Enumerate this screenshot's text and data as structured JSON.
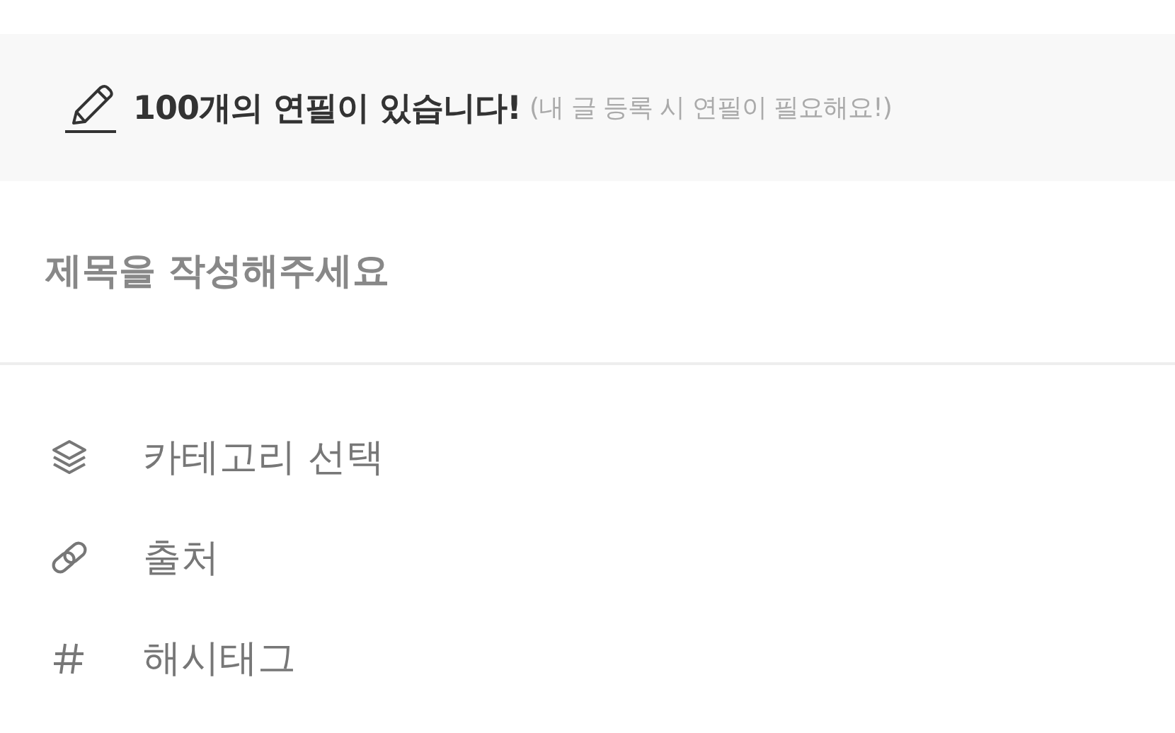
{
  "banner": {
    "message": "100개의 연필이 있습니다!",
    "note": "(내 글 등록 시 연필이 필요해요!)"
  },
  "title_field": {
    "placeholder": "제목을 작성해주세요"
  },
  "options": [
    {
      "kind": "category",
      "label": "카테고리 선택"
    },
    {
      "kind": "source",
      "label": "출처"
    },
    {
      "kind": "hashtag",
      "label": "해시태그"
    }
  ]
}
